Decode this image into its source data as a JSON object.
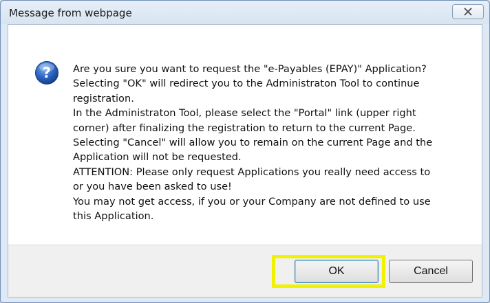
{
  "window": {
    "title": "Message from webpage"
  },
  "message": {
    "lines": [
      "Are you sure you want to request the \"e-Payables (EPAY)\" Application?",
      "Selecting \"OK\" will redirect you to the Administraton Tool to continue",
      "registration.",
      "In the Administraton Tool, please select the \"Portal\" link (upper right",
      "corner) after finalizing the registration to return to the current Page.",
      "Selecting \"Cancel\" will allow you to remain on the current Page and the",
      "Application will not be requested.",
      "ATTENTION: Please only request Applications you really need access to",
      "or you have been asked to use!",
      "You may not get access, if you or your Company are not defined to use",
      "this Application."
    ]
  },
  "buttons": {
    "ok_label": "OK",
    "cancel_label": "Cancel"
  },
  "icons": {
    "close": "close-icon",
    "question": "question-icon"
  },
  "colors": {
    "highlight": "#f2f200",
    "question_icon": "#2b63b5"
  }
}
